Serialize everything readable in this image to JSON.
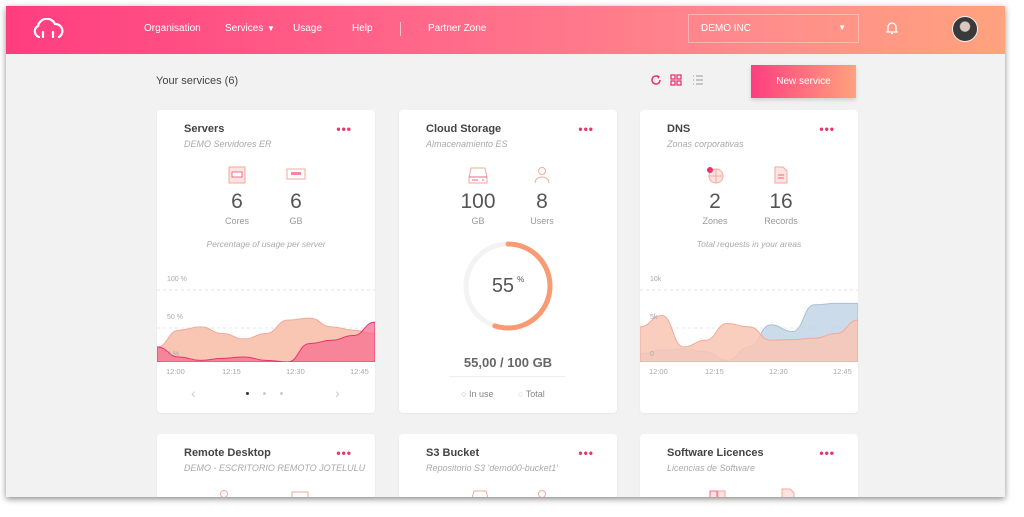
{
  "header": {
    "nav": [
      "Organisation",
      "Services",
      "Usage",
      "Help",
      "Partner Zone"
    ],
    "org_select": "DEMO INC",
    "icons": [
      "cloud-logo-icon",
      "bell-icon",
      "avatar"
    ]
  },
  "toolbar": {
    "title": "Your services (6)",
    "new_service": "New service",
    "icons": [
      "refresh-icon",
      "grid-view-icon",
      "list-view-icon"
    ]
  },
  "colors": {
    "accent": "#e8336d",
    "gradient_start": "#ff3d80",
    "gradient_end": "#ffa27e",
    "peach": "#f9c6b4",
    "pink": "#f7809e",
    "blue": "#c8d8e6"
  },
  "cards": [
    {
      "title": "Servers",
      "subtitle": "DEMO Servidores ER",
      "stats": [
        {
          "value": "6",
          "label": "Cores"
        },
        {
          "value": "6",
          "label": "GB"
        }
      ],
      "caption": "Percentage of usage per server",
      "chart": {
        "y_ticks": [
          "100 %",
          "50 %",
          "0 %"
        ],
        "ymax": 100,
        "x_ticks": [
          "12:00",
          "12:15",
          "12:30",
          "12:45"
        ],
        "series": [
          {
            "values": [
              15,
              40,
              45,
              35,
              27,
              35,
              55,
              58,
              45,
              40,
              35
            ]
          },
          {
            "values": [
              15,
              0,
              -5,
              -2,
              0,
              -5,
              -10,
              20,
              25,
              32,
              52
            ]
          }
        ]
      },
      "pager": {
        "pages": 3,
        "active": 1
      }
    },
    {
      "title": "Cloud Storage",
      "subtitle": "Almacenamiento ES",
      "stats": [
        {
          "value": "100",
          "label": "GB"
        },
        {
          "value": "8",
          "label": "Users"
        }
      ],
      "usage_percent": 55,
      "percent_sign": "%",
      "usage_text": "55,00 / 100 GB",
      "legend": [
        "In use",
        "Total"
      ]
    },
    {
      "title": "DNS",
      "subtitle": "Zonas corporativas",
      "stats": [
        {
          "value": "2",
          "label": "Zones"
        },
        {
          "value": "16",
          "label": "Records"
        }
      ],
      "caption": "Total requests in your areas",
      "chart": {
        "y_ticks": [
          "10k",
          "5k",
          "0"
        ],
        "ymax": 10000,
        "x_ticks": [
          "12:00",
          "12:15",
          "12:30",
          "12:45"
        ],
        "series": [
          {
            "values": [
              4500,
              6200,
              1500,
              2500,
              5000,
              4500,
              2500,
              2600,
              2800,
              3500,
              5500
            ]
          },
          {
            "values": [
              500,
              1000,
              1200,
              800,
              -500,
              1500,
              4800,
              3800,
              7800,
              8000,
              8000
            ]
          }
        ]
      }
    },
    {
      "title": "Remote Desktop",
      "subtitle": "DEMO - ESCRITORIO REMOTO JOTELULU"
    },
    {
      "title": "S3 Bucket",
      "subtitle": "Repositorio S3 'demo00-bucket1'"
    },
    {
      "title": "Software Licences",
      "subtitle": "Licencias de Software"
    }
  ]
}
